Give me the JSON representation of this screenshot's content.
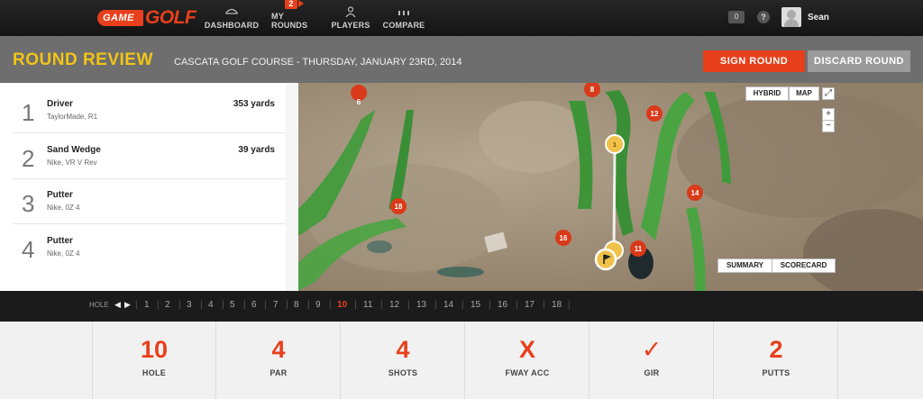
{
  "brand": {
    "game": "GAME",
    "golf": "GOLF"
  },
  "nav": {
    "items": [
      {
        "label": "DASHBOARD",
        "icon": "cap-icon"
      },
      {
        "label": "MY ROUNDS",
        "icon": "flag-badge-icon",
        "badge": "2"
      },
      {
        "label": "PLAYERS",
        "icon": "person-icon"
      },
      {
        "label": "COMPARE",
        "icon": "bars-icon"
      }
    ],
    "messages_count": "0",
    "help": "?",
    "username": "Sean"
  },
  "header": {
    "title": "ROUND REVIEW",
    "course": "CASCATA GOLF COURSE - THURSDAY, JANUARY 23RD, 2014",
    "sign_label": "SIGN ROUND",
    "discard_label": "DISCARD ROUND"
  },
  "shots": [
    {
      "num": "1",
      "club": "Driver",
      "model": "TaylorMade, R1",
      "distance": "353 yards"
    },
    {
      "num": "2",
      "club": "Sand Wedge",
      "model": "Nike, VR V Rev",
      "distance": "39 yards"
    },
    {
      "num": "3",
      "club": "Putter",
      "model": "Nike, 0Z 4",
      "distance": ""
    },
    {
      "num": "4",
      "club": "Putter",
      "model": "Nike, 0Z 4",
      "distance": ""
    }
  ],
  "map": {
    "hybrid": "HYBRID",
    "map": "MAP",
    "zoom_in": "+",
    "zoom_out": "−",
    "summary": "SUMMARY",
    "scorecard": "SCORECARD",
    "markers": [
      "6",
      "8",
      "12",
      "14",
      "18",
      "16",
      "11",
      "1"
    ]
  },
  "holes": {
    "label": "HOLE",
    "numbers": [
      "1",
      "2",
      "3",
      "4",
      "5",
      "6",
      "7",
      "8",
      "9",
      "10",
      "11",
      "12",
      "13",
      "14",
      "15",
      "16",
      "17",
      "18"
    ],
    "current": "10"
  },
  "stats": [
    {
      "value": "10",
      "label": "HOLE"
    },
    {
      "value": "4",
      "label": "PAR"
    },
    {
      "value": "4",
      "label": "SHOTS"
    },
    {
      "value": "X",
      "label": "FWAY ACC"
    },
    {
      "value": "✓",
      "label": "GIR"
    },
    {
      "value": "2",
      "label": "PUTTS"
    }
  ],
  "colors": {
    "accent": "#e8401c",
    "title_yellow": "#f3c417",
    "fairway": "#3f9b3a"
  }
}
